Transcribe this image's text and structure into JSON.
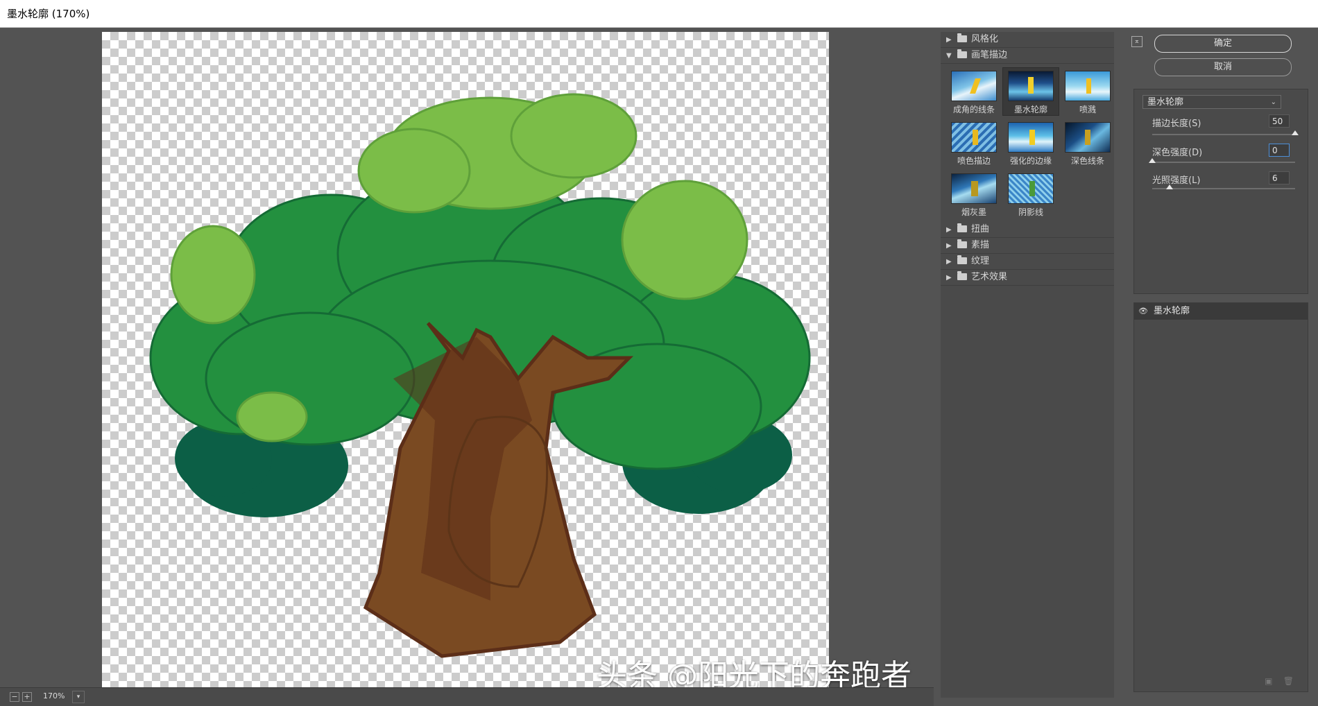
{
  "window": {
    "title": "墨水轮廓 (170%)"
  },
  "preview": {
    "zoom_value": "170%",
    "zoom_minus": "−",
    "zoom_plus": "+",
    "zoom_dropdown": "▾"
  },
  "watermark": "头条 @阳光下的奔跑者",
  "filter_gallery": {
    "groups_before": [
      {
        "label": "风格化",
        "expanded": false
      }
    ],
    "open_group": {
      "label": "画笔描边",
      "expanded": true
    },
    "thumbnails": [
      {
        "label": "成角的线条",
        "selected": false
      },
      {
        "label": "墨水轮廓",
        "selected": true
      },
      {
        "label": "喷溅",
        "selected": false
      },
      {
        "label": "喷色描边",
        "selected": false
      },
      {
        "label": "强化的边缘",
        "selected": false
      },
      {
        "label": "深色线条",
        "selected": false
      },
      {
        "label": "烟灰墨",
        "selected": false
      },
      {
        "label": "阴影线",
        "selected": false
      }
    ],
    "groups_after": [
      {
        "label": "扭曲"
      },
      {
        "label": "素描"
      },
      {
        "label": "纹理"
      },
      {
        "label": "艺术效果"
      }
    ]
  },
  "settings": {
    "collapse_icon": "⌅",
    "ok_label": "确定",
    "cancel_label": "取消",
    "filter_select": "墨水轮廓",
    "params": [
      {
        "label": "描边长度(S)",
        "value": "50",
        "fraction": 1.0
      },
      {
        "label": "深色强度(D)",
        "value": "0",
        "fraction": 0.0
      },
      {
        "label": "光照强度(L)",
        "value": "6",
        "fraction": 0.12
      }
    ]
  },
  "effect_layers": {
    "items": [
      {
        "label": "墨水轮廓",
        "visible": true
      }
    ],
    "new_icon": "▣",
    "delete_icon": "🗑"
  },
  "colors": {
    "panel_bg": "#4a4a4a",
    "workspace_bg": "#535353",
    "tree_light": "#7bbd48",
    "tree_mid": "#23903f",
    "tree_dark": "#0c5f46",
    "trunk": "#7a4a22",
    "trunk_shadow": "#5c2e18"
  }
}
